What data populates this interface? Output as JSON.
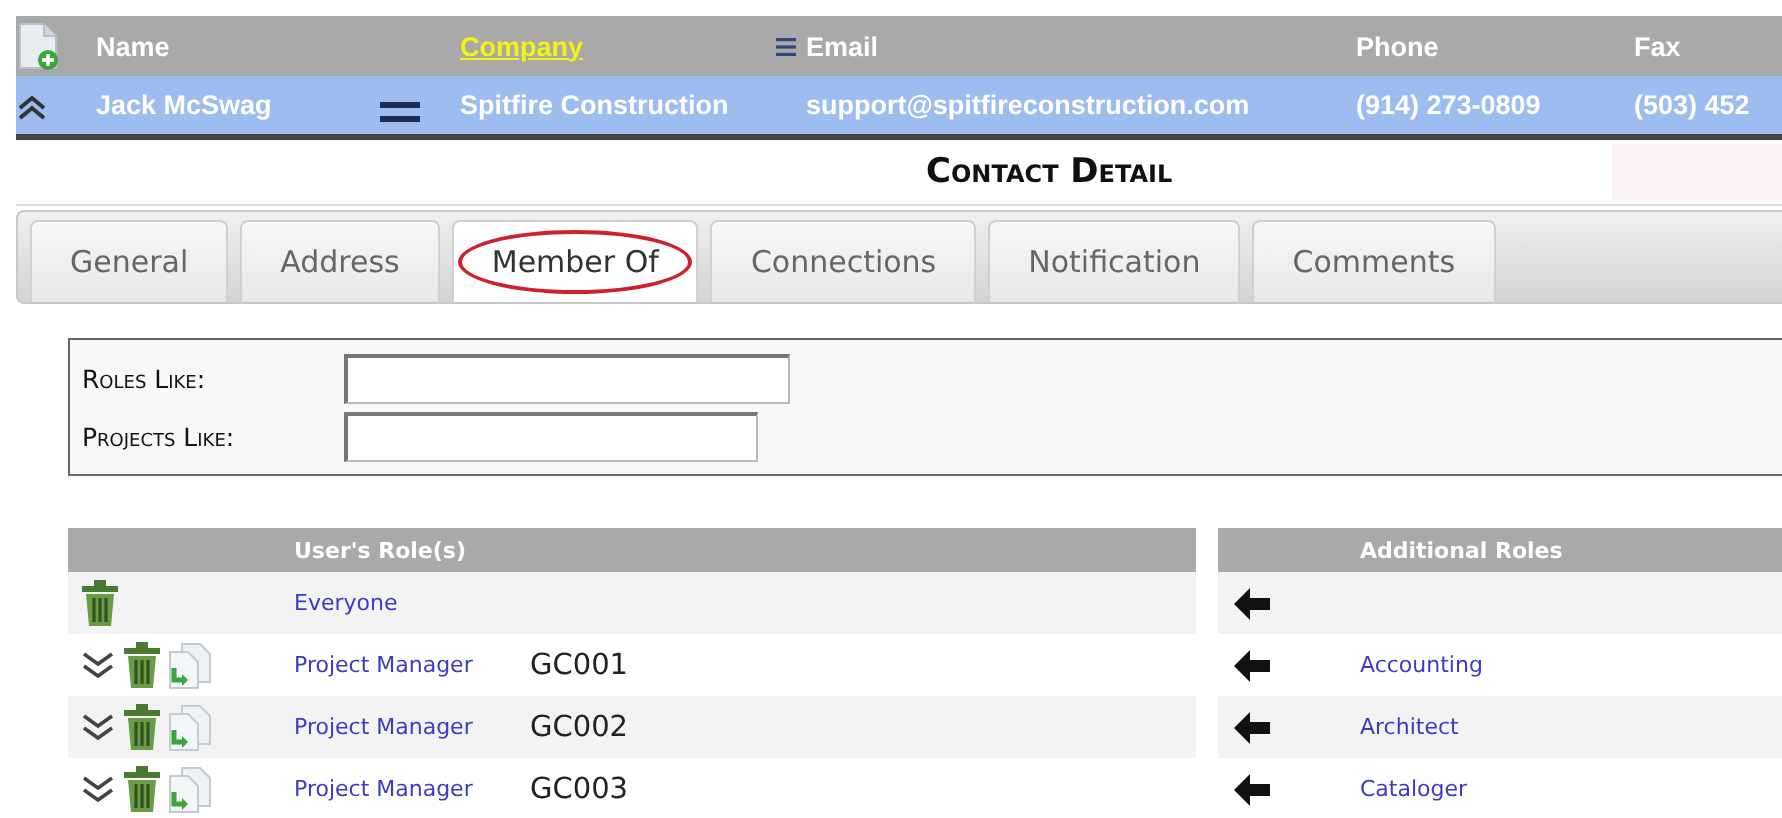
{
  "contact_list": {
    "columns": [
      {
        "label": "Name",
        "sorted": false
      },
      {
        "label": "Company",
        "sorted": true
      },
      {
        "label": "Email",
        "sorted": false
      },
      {
        "label": "Phone",
        "sorted": false
      },
      {
        "label": "Fax",
        "sorted": false
      }
    ],
    "row": {
      "name": "Jack McSwag",
      "company": "Spitfire Construction",
      "email": "support@spitfireconstruction.com",
      "phone": "(914) 273-0809",
      "fax": "(503) 452",
      "expanded": true
    }
  },
  "title": "Contact Detail",
  "tabs": [
    {
      "label": "General",
      "selected": false,
      "circled": false
    },
    {
      "label": "Address",
      "selected": false,
      "circled": false
    },
    {
      "label": "Member Of",
      "selected": true,
      "circled": true
    },
    {
      "label": "Connections",
      "selected": false,
      "circled": false
    },
    {
      "label": "Notification",
      "selected": false,
      "circled": false
    },
    {
      "label": "Comments",
      "selected": false,
      "circled": false
    }
  ],
  "filters": [
    {
      "label": "Roles Like:"
    },
    {
      "label": "Projects Like:"
    }
  ],
  "user_roles": {
    "title": "User's Role(s)",
    "rows": [
      {
        "kind": "base",
        "role": "Everyone"
      },
      {
        "kind": "project",
        "role": "Project Manager",
        "project": "GC001",
        "expanded": false
      },
      {
        "kind": "project",
        "role": "Project Manager",
        "project": "GC002",
        "expanded": false
      },
      {
        "kind": "project",
        "role": "Project Manager",
        "project": "GC003",
        "expanded": false
      }
    ]
  },
  "additional_roles": {
    "title": "Additional Roles",
    "rows": [
      {
        "kind": "blank"
      },
      {
        "kind": "role",
        "name": "Accounting"
      },
      {
        "kind": "role",
        "name": "Architect"
      },
      {
        "kind": "role",
        "name": "Cataloger"
      }
    ]
  }
}
